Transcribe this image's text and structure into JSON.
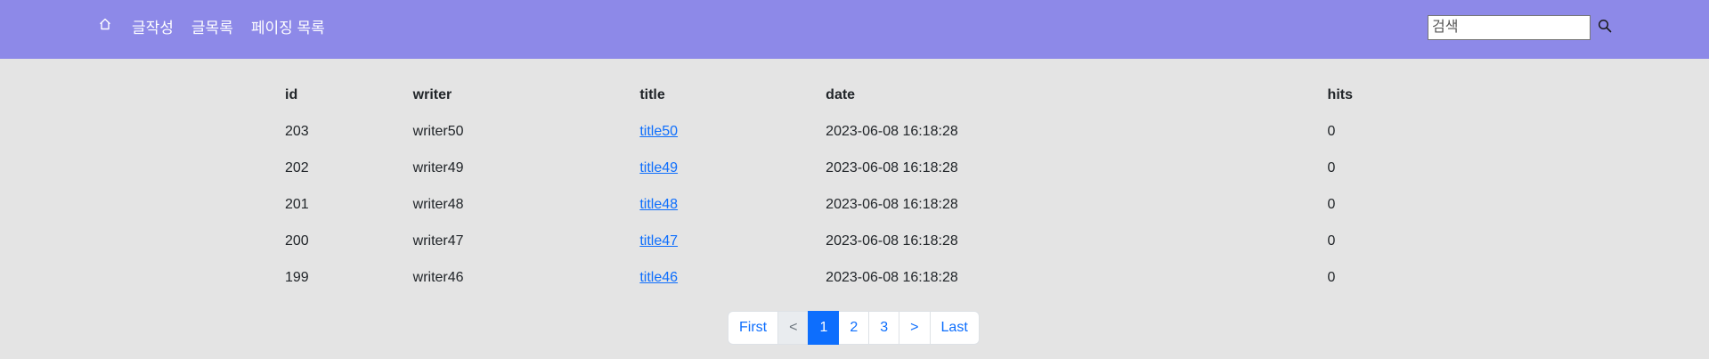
{
  "nav": {
    "home_icon": "home-icon",
    "items": [
      {
        "label": "글작성"
      },
      {
        "label": "글목록"
      },
      {
        "label": "페이징 목록"
      }
    ]
  },
  "search": {
    "placeholder": "검색",
    "icon": "search-icon"
  },
  "table": {
    "headers": [
      "id",
      "writer",
      "title",
      "date",
      "hits"
    ],
    "rows": [
      {
        "id": "203",
        "writer": "writer50",
        "title": "title50",
        "date": "2023-06-08 16:18:28",
        "hits": "0"
      },
      {
        "id": "202",
        "writer": "writer49",
        "title": "title49",
        "date": "2023-06-08 16:18:28",
        "hits": "0"
      },
      {
        "id": "201",
        "writer": "writer48",
        "title": "title48",
        "date": "2023-06-08 16:18:28",
        "hits": "0"
      },
      {
        "id": "200",
        "writer": "writer47",
        "title": "title47",
        "date": "2023-06-08 16:18:28",
        "hits": "0"
      },
      {
        "id": "199",
        "writer": "writer46",
        "title": "title46",
        "date": "2023-06-08 16:18:28",
        "hits": "0"
      }
    ]
  },
  "pagination": {
    "first": "First",
    "prev": "<",
    "pages": [
      "1",
      "2",
      "3"
    ],
    "next": ">",
    "last": "Last",
    "current": "1"
  },
  "colors": {
    "navbar": "#8d89e8",
    "background": "#e4e4e4",
    "link": "#0d6efd",
    "active_page": "#0d6efd"
  }
}
